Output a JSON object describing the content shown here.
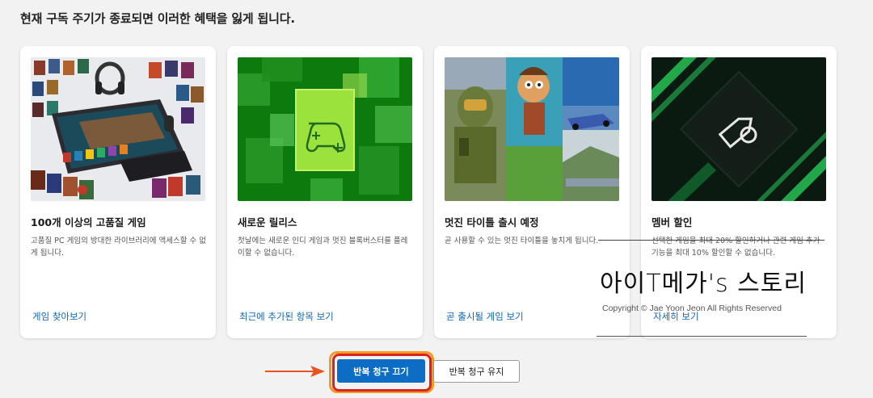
{
  "heading": "현재 구독 주기가 종료되면 이러한 혜택을 잃게 됩니다.",
  "cards": [
    {
      "title": "100개 이상의 고품질 게임",
      "desc": "고품질 PC 게임의 방대한 라이브러리에 액세스할 수 없게 됩니다.",
      "link": "게임 찾아보기"
    },
    {
      "title": "새로운 릴리스",
      "desc": "첫날에는 새로운 인디 게임과 멋진 블록버스터를 플레이할 수 없습니다.",
      "link": "최근에 추가된 항목 보기"
    },
    {
      "title": "멋진 타이틀 출시 예정",
      "desc": "곧 사용할 수 있는 멋진 타이틀을 놓치게 됩니다.",
      "link": "곧 출시될 게임 보기"
    },
    {
      "title": "멤버 할인",
      "desc": "선택한 게임을 최대 20% 할인하거나 관련 게임 추가 기능을 최대 10% 할인할 수 없습니다.",
      "link": "자세히 보기"
    }
  ],
  "buttons": {
    "turn_off": "반복 청구 끄기",
    "keep": "반복 청구 유지"
  },
  "watermark": {
    "title": "아이T메가's 스토리",
    "copyright": "Copyright © Jae Yoon Jeon All Rights Reserved"
  },
  "colors": {
    "primary_button": "#0d6dc4",
    "link": "#1166b3",
    "highlight_red": "#d9231f",
    "highlight_orange": "#f39a22",
    "arrow": "#e8531f"
  }
}
